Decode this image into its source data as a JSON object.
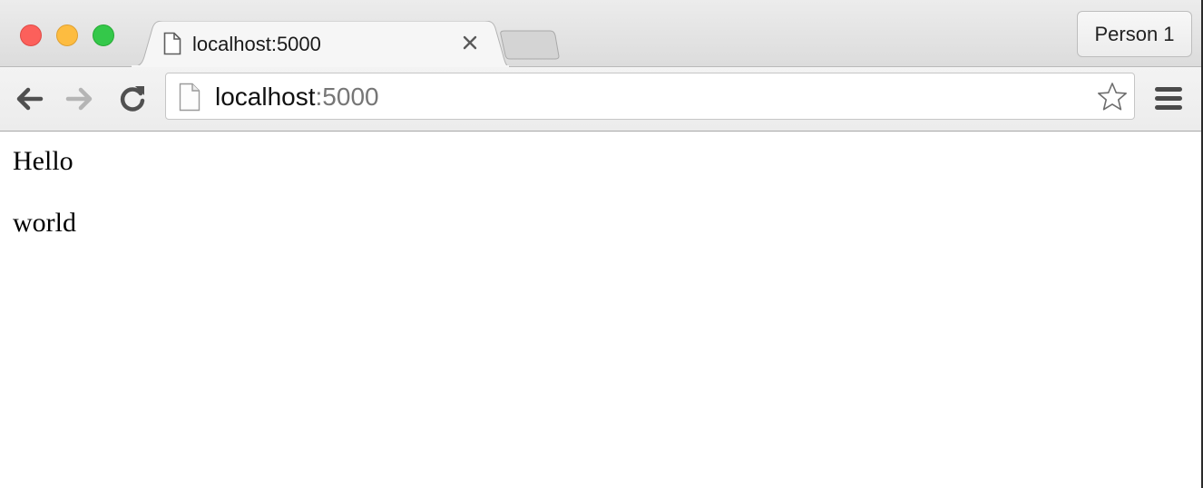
{
  "tab": {
    "title": "localhost:5000"
  },
  "profile": {
    "label": "Person 1"
  },
  "omnibox": {
    "host": "localhost",
    "port": ":5000"
  },
  "page": {
    "paragraphs": [
      "Hello",
      "world"
    ]
  },
  "colors": {
    "close": "#fc605b",
    "minimize": "#fdbc40",
    "maximize": "#34c84a"
  },
  "icons": [
    "page-icon",
    "close-icon",
    "back-arrow-icon",
    "forward-arrow-icon",
    "reload-icon",
    "star-icon",
    "hamburger-menu-icon"
  ]
}
